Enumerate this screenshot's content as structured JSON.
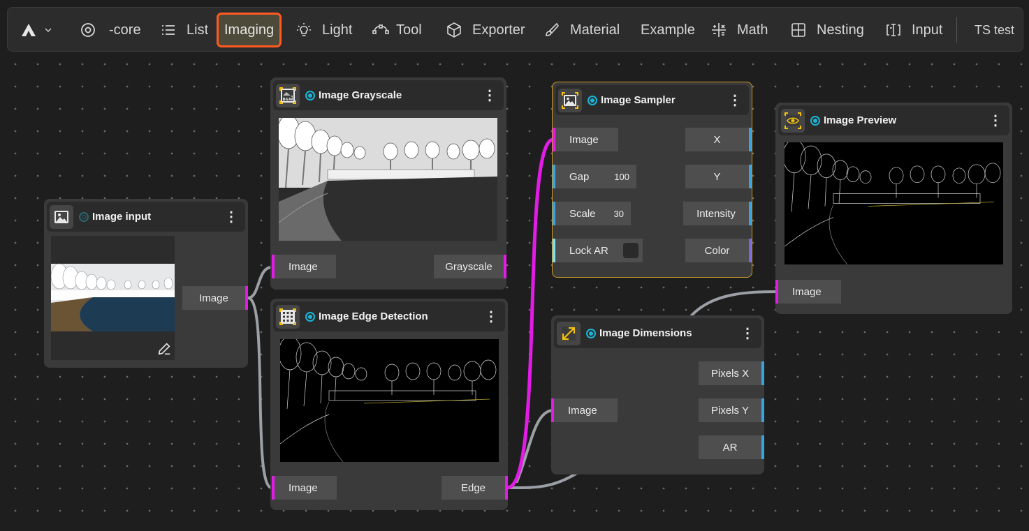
{
  "toolbar": {
    "items": [
      {
        "label": "-core",
        "icon": "target-icon"
      },
      {
        "label": "List",
        "icon": "list-icon"
      },
      {
        "label": "Imaging",
        "icon": ""
      },
      {
        "label": "Light",
        "icon": "lightbulb-icon"
      },
      {
        "label": "Tool",
        "icon": "bezier-icon"
      },
      {
        "label": "Exporter",
        "icon": "cube-icon"
      },
      {
        "label": "Material",
        "icon": "brush-icon"
      },
      {
        "label": "Example",
        "icon": ""
      },
      {
        "label": "Math",
        "icon": "math-icon"
      },
      {
        "label": "Nesting",
        "icon": "grid-icon"
      },
      {
        "label": "Input",
        "icon": "text-cursor-icon"
      }
    ],
    "ts_test": "TS test",
    "active": "Imaging"
  },
  "nodes": {
    "image_input": {
      "title": "Image input",
      "out_image": "Image"
    },
    "grayscale": {
      "title": "Image Grayscale",
      "icon_text": "B&W",
      "in_image": "Image",
      "out_grayscale": "Grayscale"
    },
    "edge": {
      "title": "Image Edge Detection",
      "in_image": "Image",
      "out_edge": "Edge"
    },
    "sampler": {
      "title": "Image Sampler",
      "in_image": "Image",
      "gap_label": "Gap",
      "gap_value": "100",
      "scale_label": "Scale",
      "scale_value": "30",
      "lock_label": "Lock AR",
      "out_x": "X",
      "out_y": "Y",
      "out_intensity": "Intensity",
      "out_color": "Color"
    },
    "dimensions": {
      "title": "Image Dimensions",
      "in_image": "Image",
      "out_px": "Pixels X",
      "out_py": "Pixels Y",
      "out_ar": "AR"
    },
    "preview": {
      "title": "Image Preview",
      "in_image": "Image"
    }
  },
  "colors": {
    "accent_active": "#ff5a1f",
    "image_port": "#e21ce6",
    "number_port": "#3aa4e2",
    "bool_port": "#7ee0ef",
    "color_port": "#7a6adf",
    "status_dot": "#19b6d8",
    "selected_border": "#c89a2a"
  }
}
